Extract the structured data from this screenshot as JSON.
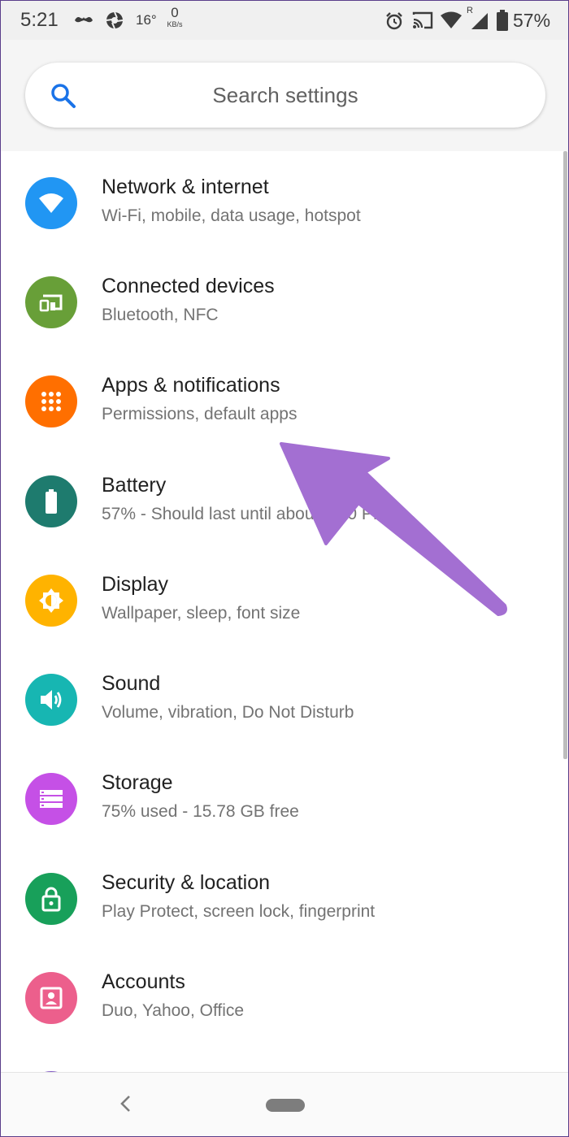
{
  "status_bar": {
    "time": "5:21",
    "temperature": "16°",
    "speed_value": "0",
    "speed_unit": "KB/s",
    "battery_percent": "57%",
    "icons": [
      "mustache-icon",
      "aperture-icon",
      "alarm-icon",
      "cast-icon",
      "wifi-icon",
      "signal-icon",
      "battery-icon"
    ]
  },
  "search": {
    "placeholder": "Search settings"
  },
  "settings_items": [
    {
      "title": "Network & internet",
      "subtitle": "Wi-Fi, mobile, data usage, hotspot",
      "color": "#2196f3",
      "icon": "wifi-icon"
    },
    {
      "title": "Connected devices",
      "subtitle": "Bluetooth, NFC",
      "color": "#689f38",
      "icon": "devices-icon"
    },
    {
      "title": "Apps & notifications",
      "subtitle": "Permissions, default apps",
      "color": "#ff6f00",
      "icon": "apps-grid-icon"
    },
    {
      "title": "Battery",
      "subtitle": "57% - Should last until about 9:00 PM",
      "color": "#1e7b6e",
      "icon": "battery-icon"
    },
    {
      "title": "Display",
      "subtitle": "Wallpaper, sleep, font size",
      "color": "#ffb300",
      "icon": "brightness-icon"
    },
    {
      "title": "Sound",
      "subtitle": "Volume, vibration, Do Not Disturb",
      "color": "#17b6b2",
      "icon": "volume-icon"
    },
    {
      "title": "Storage",
      "subtitle": "75% used - 15.78 GB free",
      "color": "#c550e6",
      "icon": "storage-icon"
    },
    {
      "title": "Security & location",
      "subtitle": "Play Protect, screen lock, fingerprint",
      "color": "#18a05a",
      "icon": "lock-icon"
    },
    {
      "title": "Accounts",
      "subtitle": "Duo, Yahoo, Office",
      "color": "#ec5f8c",
      "icon": "account-icon"
    }
  ],
  "annotation": {
    "color": "#a36fd2",
    "icon": "pointer-arrow-icon"
  },
  "nav_bar": {
    "icons": [
      "back-icon",
      "home-pill-icon"
    ]
  }
}
